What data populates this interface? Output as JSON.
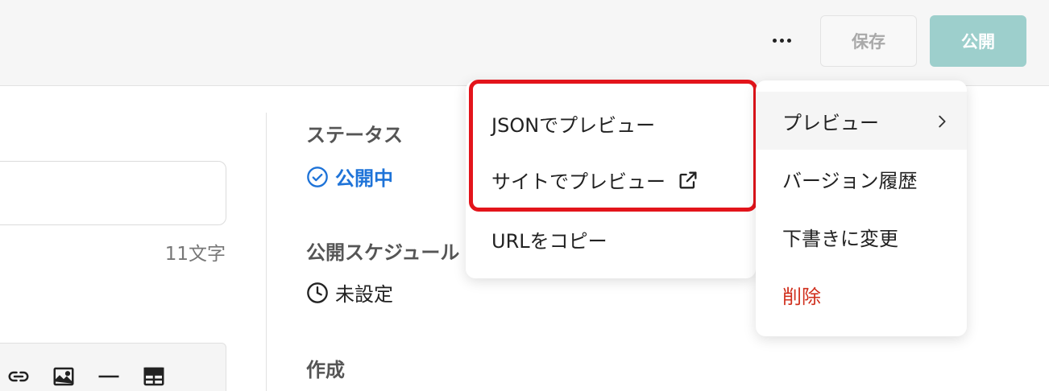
{
  "header": {
    "save_label": "保存",
    "publish_label": "公開",
    "more_icon": "more-horizontal-icon"
  },
  "editor": {
    "char_count": "11文字",
    "toolbar_icons": [
      "link-icon",
      "image-icon",
      "horizontal-rule-icon",
      "table-icon"
    ]
  },
  "sidebar": {
    "status_heading": "ステータス",
    "status_value": "公開中",
    "status_color": "#1e73d8",
    "schedule_heading": "公開スケジュール",
    "schedule_value": "未設定",
    "created_heading": "作成"
  },
  "menu": {
    "items": [
      {
        "label": "プレビュー",
        "has_submenu": true
      },
      {
        "label": "バージョン履歴"
      },
      {
        "label": "下書きに変更"
      },
      {
        "label": "削除",
        "danger": true
      }
    ],
    "danger_color": "#d0301e"
  },
  "submenu": {
    "items": [
      {
        "label": "JSONでプレビュー"
      },
      {
        "label": "サイトでプレビュー",
        "icon": "external-link-icon"
      },
      {
        "label": "URLをコピー"
      }
    ]
  },
  "highlight_color": "#e3141b"
}
